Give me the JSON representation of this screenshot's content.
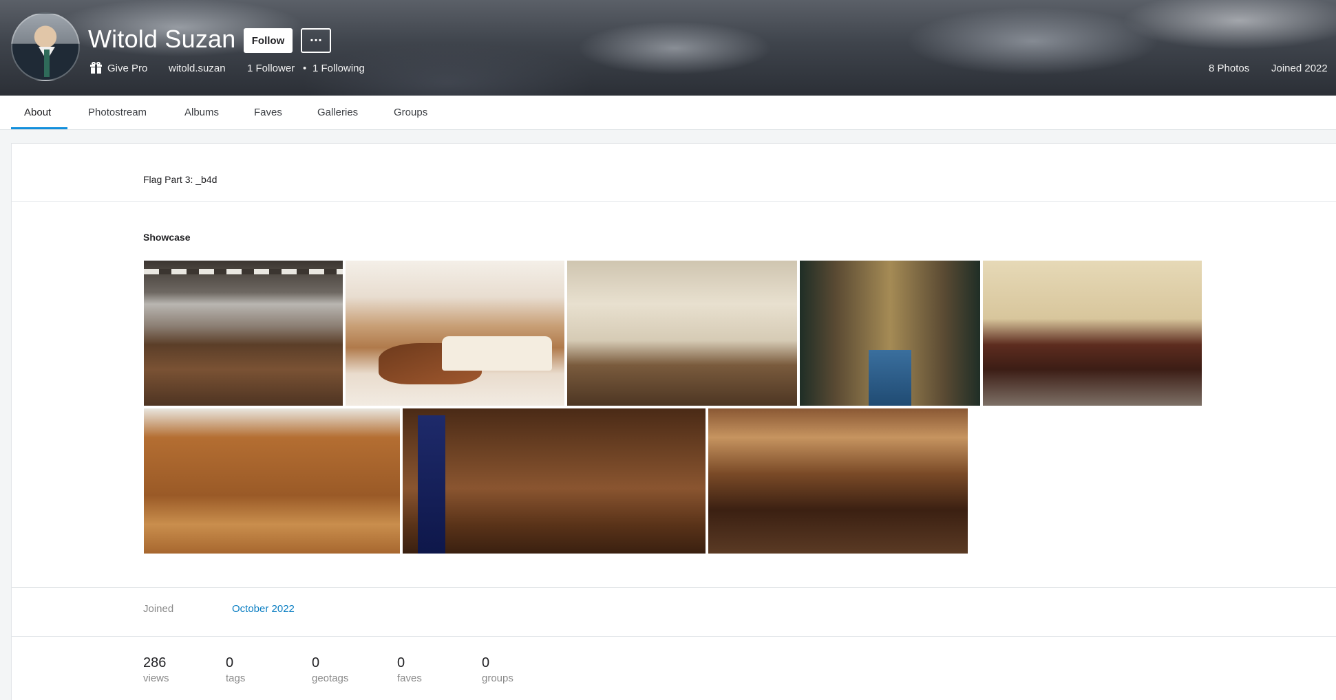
{
  "header": {
    "display_name": "Witold Suzan",
    "follow_label": "Follow",
    "more_label": "···",
    "give_pro": "Give Pro",
    "username": "witold.suzan",
    "followers": "1 Follower",
    "separator": "•",
    "following": "1 Following",
    "photos_count": "8 Photos",
    "joined": "Joined 2022"
  },
  "tabs": [
    {
      "label": "About",
      "active": true
    },
    {
      "label": "Photostream"
    },
    {
      "label": "Albums"
    },
    {
      "label": "Faves"
    },
    {
      "label": "Galleries"
    },
    {
      "label": "Groups"
    }
  ],
  "about": {
    "description": "Flag Part 3: _b4d",
    "showcase_title": "Showcase",
    "joined_label": "Joined",
    "joined_value": "October 2022"
  },
  "stats": [
    {
      "value": "286",
      "label": "views"
    },
    {
      "value": "0",
      "label": "tags"
    },
    {
      "value": "0",
      "label": "geotags"
    },
    {
      "value": "0",
      "label": "faves"
    },
    {
      "value": "0",
      "label": "groups"
    }
  ],
  "colors": {
    "accent": "#128fdc",
    "link": "#0b7ec2"
  }
}
